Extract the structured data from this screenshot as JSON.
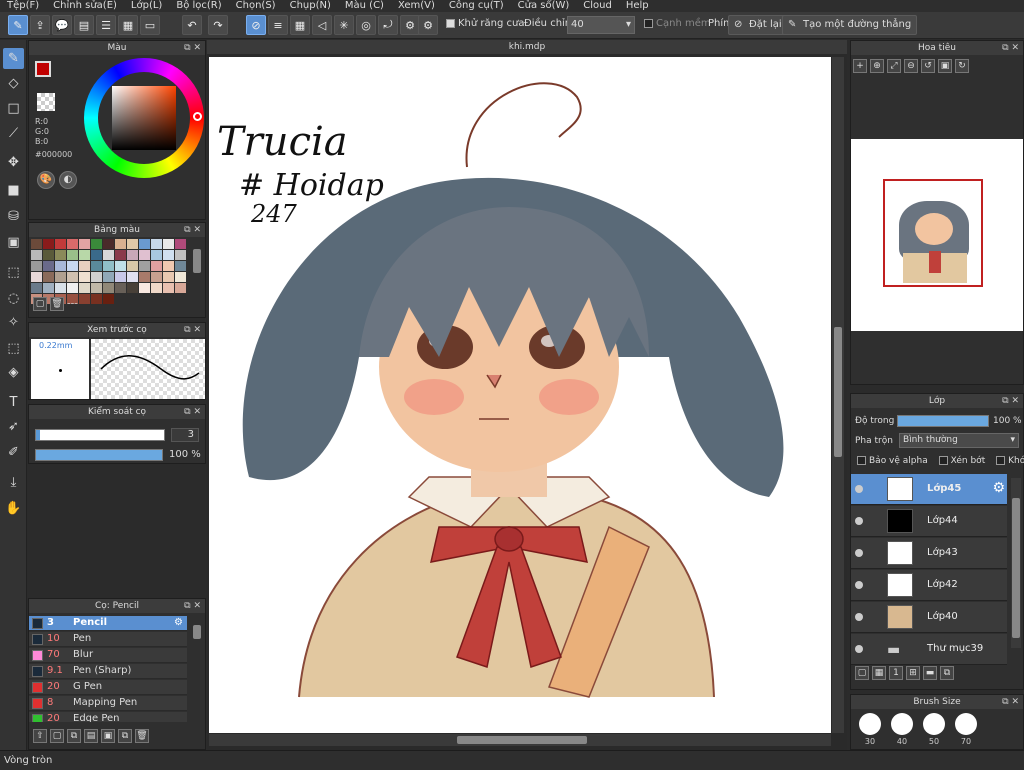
{
  "menu": [
    "Tệp(F)",
    "Chỉnh sửa(E)",
    "Lớp(L)",
    "Bộ lọc(R)",
    "Chọn(S)",
    "Chụp(N)",
    "Màu (C)",
    "Xem(V)",
    "Công cụ(T)",
    "Cửa sổ(W)",
    "Cloud",
    "Help"
  ],
  "toolbar": {
    "antialias_label": "Khử răng cưa",
    "adjust_label": "Điều chỉnh",
    "adjust_value": "40",
    "soft_edge_label": "Cạnh mềm",
    "key_label": "Phím",
    "reset_label": "Đặt lại",
    "straight_line_label": "Tạo một đường thẳng"
  },
  "color_panel": {
    "title": "Màu",
    "r": "R:0",
    "g": "G:0",
    "b": "B:0",
    "hex": "#000000",
    "primary": "#c00000",
    "secondary": "#6b3a1e"
  },
  "palette_panel": {
    "title": "Bảng màu",
    "footer": "---",
    "colors": [
      "#6b4a3a",
      "#8a1b1b",
      "#c23a3a",
      "#d96a6a",
      "#e3a3a3",
      "#3a8a3a",
      "#4a2a2a",
      "#d9b090",
      "#e0c8a8",
      "#6a9ad0",
      "#c8d8e8",
      "#e8e8e8",
      "#b04a7a",
      "#b8b8b8",
      "#5a5a3a",
      "#8a8a5a",
      "#9ac08a",
      "#b8d8a8",
      "#3a6a8a",
      "#d8d8d8",
      "#8a3a4a",
      "#c8a8b8",
      "#e0c0d0",
      "#a8c8e0",
      "#d0e0f0",
      "#c0c0c0",
      "#9a9a9a",
      "#6a6a8a",
      "#a8b8d8",
      "#c8d8f0",
      "#e8d0c0",
      "#5a8a9a",
      "#90c0c8",
      "#c0e0e8",
      "#d8c8a8",
      "#a0a0a0",
      "#e0a0a0",
      "#f0c8b0",
      "#708898",
      "#e8d8d8",
      "#8a6a5a",
      "#b0a090",
      "#d0c0b0",
      "#f0e0d0",
      "#d0d0d0",
      "#90a8b8",
      "#c8c8e8",
      "#e0e0f0",
      "#a87a6a",
      "#c8a090",
      "#e8c8b0",
      "#f0e8d8",
      "#6a7a8a",
      "#a0b0c0",
      "#d8e0e8",
      "#f0f0f0",
      "#e0d8c8",
      "#c0b8a8",
      "#908878",
      "#686058",
      "#484038",
      "#f8e8e0",
      "#f0d8c8",
      "#e8c0b0",
      "#d8a898",
      "#c89080",
      "#b87868",
      "#a86050",
      "#985040",
      "#884030",
      "#783020",
      "#682010"
    ]
  },
  "brush_preview": {
    "title": "Xem trước cọ",
    "size_label": "0.22mm"
  },
  "brush_control": {
    "title": "Kiểm soát cọ",
    "size_value": "3",
    "opacity_value": "100 %",
    "size_fraction": 0.03,
    "opacity_fraction": 1.0
  },
  "brush_list": {
    "title": "Cọ: Pencil",
    "items": [
      {
        "size": "3",
        "name": "Pencil",
        "color": "#1a2a3a",
        "selected": true
      },
      {
        "size": "10",
        "name": "Pen",
        "color": "#1a2a3a",
        "selected": false
      },
      {
        "size": "70",
        "name": "Blur",
        "color": "#ff8ad8",
        "selected": false
      },
      {
        "size": "9.1",
        "name": "Pen (Sharp)",
        "color": "#1a2a3a",
        "selected": false
      },
      {
        "size": "20",
        "name": "G Pen",
        "color": "#e03030",
        "selected": false
      },
      {
        "size": "8",
        "name": "Mapping Pen",
        "color": "#e03030",
        "selected": false
      },
      {
        "size": "20",
        "name": "Edge Pen",
        "color": "#30c030",
        "selected": false
      }
    ]
  },
  "document": {
    "tab": "khi.mdp",
    "handwriting": [
      "Trucia",
      "# Hoidap",
      "247"
    ]
  },
  "navigator": {
    "title": "Hoa tiêu"
  },
  "layers": {
    "title": "Lớp",
    "opacity_label": "Độ trong",
    "opacity_value": "100 %",
    "opacity_fraction": 1.0,
    "blend_label": "Pha trộn",
    "blend_value": "Bình thường",
    "protect_alpha": "Bảo vệ alpha",
    "clipping": "Xén bớt",
    "lock": "Khóa",
    "items": [
      {
        "name": "Lớp45",
        "selected": true
      },
      {
        "name": "Lớp44",
        "selected": false
      },
      {
        "name": "Lớp43",
        "selected": false
      },
      {
        "name": "Lớp42",
        "selected": false
      },
      {
        "name": "Lớp40",
        "selected": false
      },
      {
        "name": "Thư mục39",
        "selected": false
      }
    ]
  },
  "brush_size_panel": {
    "title": "Brush Size",
    "sizes": [
      "30",
      "40",
      "50",
      "70"
    ]
  },
  "status": {
    "text": "Vòng tròn"
  }
}
